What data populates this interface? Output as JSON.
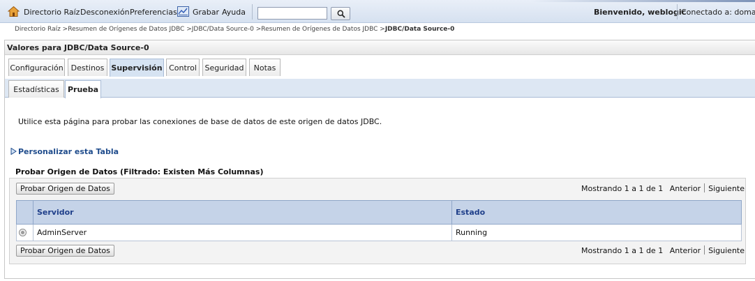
{
  "topbar": {
    "home": "Directorio Raíz",
    "logout": "Desconexión",
    "preferences": "Preferencias",
    "record": "Grabar",
    "help": "Ayuda",
    "search_value": "",
    "welcome": "Bienvenido, weblogic",
    "connected": "Conectado a: domain"
  },
  "breadcrumb": {
    "path": "Directorio Raíz >Resumen de Orígenes de Datos JDBC >JDBC/Data Source-0 >Resumen de Orígenes de Datos JDBC >",
    "current": "JDBC/Data Source-0"
  },
  "panel": {
    "title": "Valores para JDBC/Data Source-0",
    "tabs": [
      "Configuración",
      "Destinos",
      "Supervisión",
      "Control",
      "Seguridad",
      "Notas"
    ],
    "active_tab": "Supervisión",
    "subtabs": [
      "Estadísticas",
      "Prueba"
    ],
    "active_subtab": "Prueba",
    "description": "Utilice esta página para probar las conexiones de base de datos de este origen de datos JDBC.",
    "customize_link": "Personalizar esta Tabla"
  },
  "table": {
    "title": "Probar Origen de Datos (Filtrado: Existen Más Columnas)",
    "action_button": "Probar Origen de Datos",
    "pager_text": "Mostrando 1 a 1 de 1",
    "prev": "Anterior",
    "next": "Siguiente",
    "columns": [
      "Servidor",
      "Estado"
    ],
    "rows": [
      {
        "server": "AdminServer",
        "status": "Running"
      }
    ]
  },
  "colors": {
    "header_bg": "#c5d3e8",
    "header_text": "#1f3f8a",
    "link": "#1f4c8c"
  }
}
